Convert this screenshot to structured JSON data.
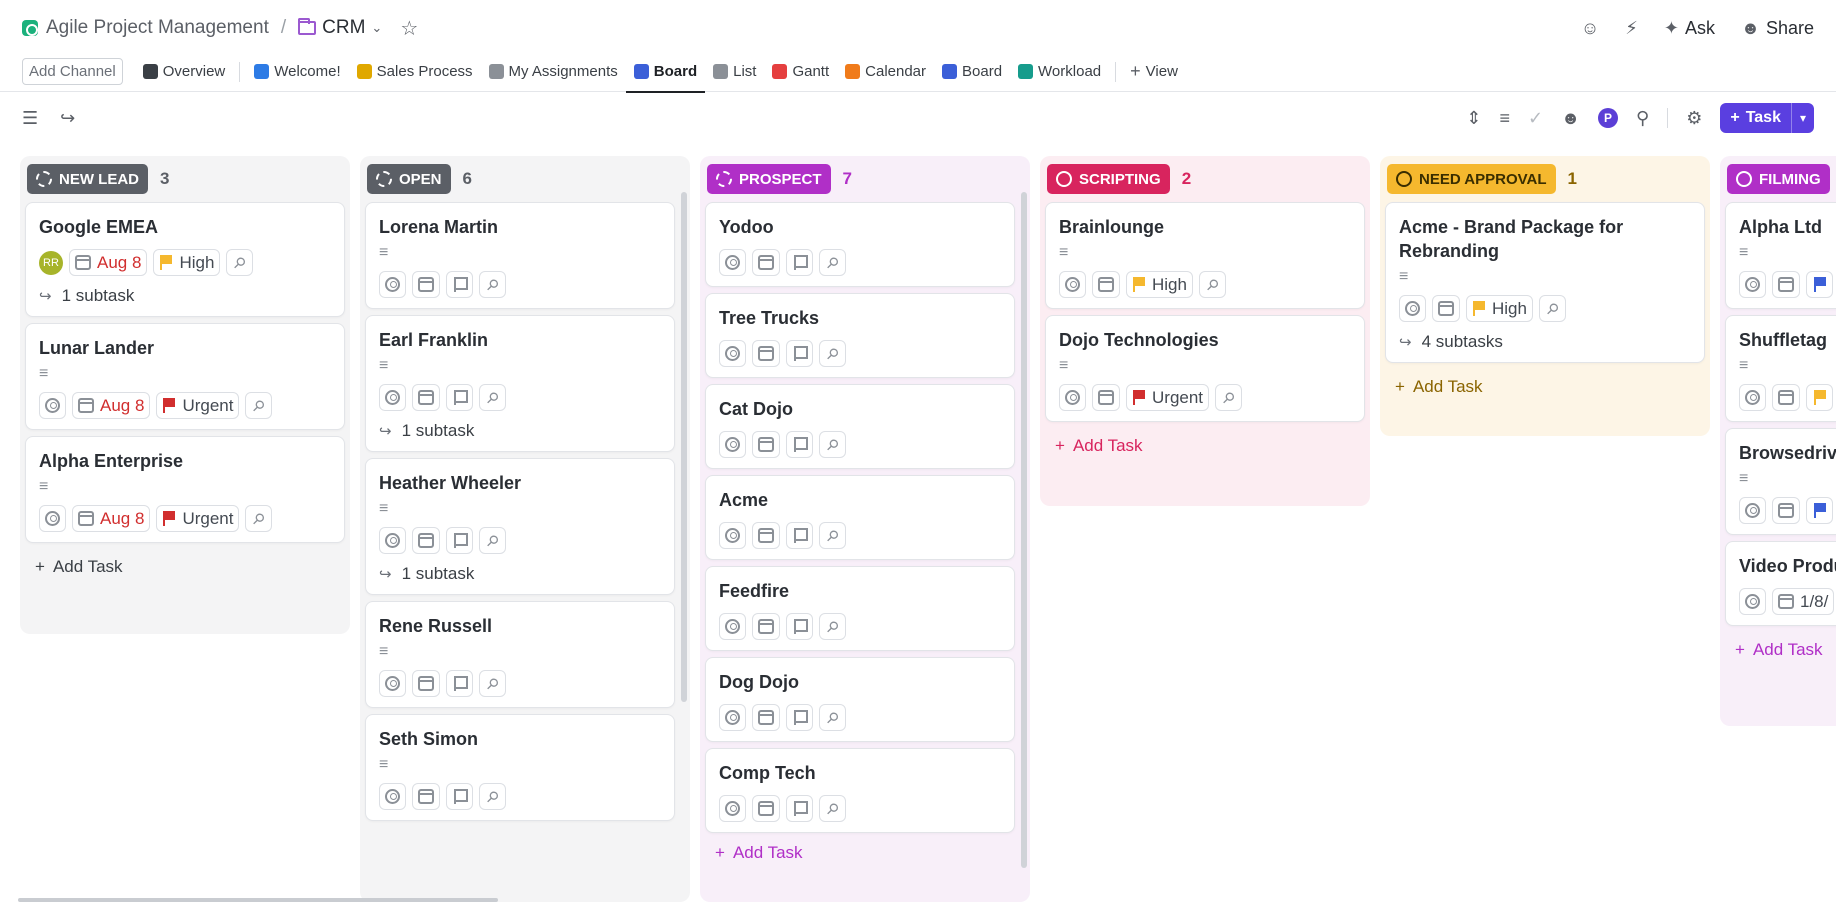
{
  "header": {
    "breadcrumb_space": "Agile Project Management",
    "breadcrumb_sep": "/",
    "breadcrumb_folder": "CRM",
    "ask_label": "Ask",
    "share_label": "Share"
  },
  "tabs": {
    "add_channel": "Add Channel",
    "items": [
      {
        "label": "Overview",
        "icon": "info-icon",
        "color": "#3a3f45"
      },
      {
        "label": "Welcome!",
        "icon": "doc-icon",
        "color": "#2d7be5"
      },
      {
        "label": "Sales Process",
        "icon": "doc-icon",
        "color": "#e0a800"
      },
      {
        "label": "My Assignments",
        "icon": "doc-icon",
        "color": "#6b7078"
      },
      {
        "label": "Board",
        "icon": "board-icon",
        "color": "#3b5fd8"
      },
      {
        "label": "List",
        "icon": "list-icon",
        "color": "#6b7078"
      },
      {
        "label": "Gantt",
        "icon": "gantt-icon",
        "color": "#e53f3f"
      },
      {
        "label": "Calendar",
        "icon": "calendar-icon",
        "color": "#f07b1a"
      },
      {
        "label": "Board",
        "icon": "board-icon",
        "color": "#3b5fd8"
      },
      {
        "label": "Workload",
        "icon": "workload-icon",
        "color": "#169c8c"
      }
    ],
    "add_view": "View"
  },
  "toolbar": {
    "avatar_initial": "P",
    "task_button": "Task"
  },
  "colors": {
    "new_lead": "#5b5f66",
    "open": "#5b5f66",
    "prospect": "#b02fc7",
    "scripting": "#d8245e",
    "need_approval": "#f5b82e",
    "filming": "#b02fc7",
    "urgent": "#d12e2e",
    "high": "#f5b82e",
    "normal": "#3b5fd8"
  },
  "columns": [
    {
      "status": "NEW LEAD",
      "count": "3",
      "add_task": "Add Task",
      "cards": [
        {
          "title": "Google EMEA",
          "assignee": "RR",
          "date": "Aug 8",
          "priority": "High",
          "subtasks": "1 subtask"
        },
        {
          "title": "Lunar Lander",
          "date": "Aug 8",
          "priority": "Urgent"
        },
        {
          "title": "Alpha Enterprise",
          "date": "Aug 8",
          "priority": "Urgent"
        }
      ]
    },
    {
      "status": "OPEN",
      "count": "6",
      "cards": [
        {
          "title": "Lorena Martin"
        },
        {
          "title": "Earl Franklin",
          "subtasks": "1 subtask"
        },
        {
          "title": "Heather Wheeler",
          "subtasks": "1 subtask"
        },
        {
          "title": "Rene Russell"
        },
        {
          "title": "Seth Simon"
        }
      ]
    },
    {
      "status": "PROSPECT",
      "count": "7",
      "add_task": "Add Task",
      "cards": [
        {
          "title": "Yodoo"
        },
        {
          "title": "Tree Trucks"
        },
        {
          "title": "Cat Dojo"
        },
        {
          "title": "Acme"
        },
        {
          "title": "Feedfire"
        },
        {
          "title": "Dog Dojo"
        },
        {
          "title": "Comp Tech"
        }
      ]
    },
    {
      "status": "SCRIPTING",
      "count": "2",
      "add_task": "Add Task",
      "cards": [
        {
          "title": "Brainlounge",
          "priority": "High"
        },
        {
          "title": "Dojo Technologies",
          "priority": "Urgent"
        }
      ]
    },
    {
      "status": "NEED APPROVAL",
      "count": "1",
      "add_task": "Add Task",
      "cards": [
        {
          "title": "Acme - Brand Package for Rebranding",
          "priority": "High",
          "subtasks": "4 subtasks"
        }
      ]
    },
    {
      "status": "FILMING",
      "count": "",
      "add_task": "Add Task",
      "cards": [
        {
          "title": "Alpha Ltd"
        },
        {
          "title": "Shuffletag"
        },
        {
          "title": "Browsedrive"
        },
        {
          "title": "Video Produ",
          "date_partial": "1/8/"
        }
      ]
    }
  ]
}
